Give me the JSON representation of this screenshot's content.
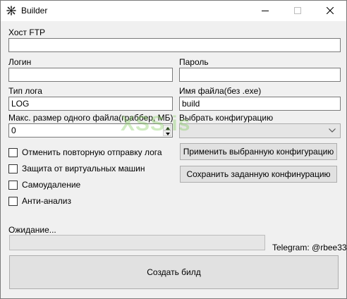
{
  "window": {
    "title": "Builder"
  },
  "form": {
    "ftp_host_label": "Хост FTP",
    "ftp_host_value": "",
    "login_label": "Логин",
    "login_value": "",
    "password_label": "Пароль",
    "password_value": "",
    "log_type_label": "Тип лога",
    "log_type_value": "LOG",
    "filename_label": "Имя файла(без .exe)",
    "filename_value": "build",
    "max_size_label": "Макс. размер одного файла(граббер, МБ)",
    "max_size_value": "0",
    "config_label": "Выбрать конфигурацию",
    "config_value": ""
  },
  "options": [
    {
      "label": "Отменить повторную отправку лога",
      "checked": false
    },
    {
      "label": "Защита от виртуальных машин",
      "checked": false
    },
    {
      "label": "Самоудаление",
      "checked": false
    },
    {
      "label": "Анти-анализ",
      "checked": false
    }
  ],
  "buttons": {
    "apply_config": "Применить выбранную конфигурацию",
    "save_config": "Сохранить заданную конфинурацию",
    "build": "Создать билд"
  },
  "status": {
    "waiting_label": "Ожидание...",
    "progress": 0,
    "telegram": "Telegram: @rbee33"
  },
  "watermark": "XSS.is",
  "colors": {
    "progress_fill": "#06b025"
  }
}
